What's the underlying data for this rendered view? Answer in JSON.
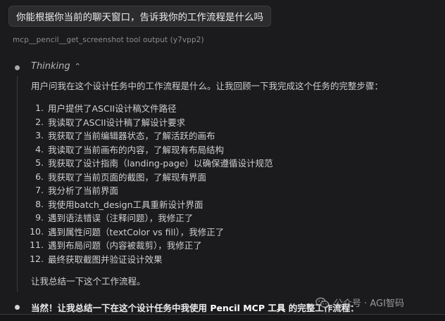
{
  "user_message": {
    "text": "你能根据你当前的聊天窗口，告诉我你的工作流程是什么吗"
  },
  "tool_output": {
    "label": "mcp__pencil__get_screenshot tool output (y7vpp2)"
  },
  "thinking": {
    "label": "Thinking",
    "toggle_icon": "chevron-up-icon",
    "intro": "用户问我在这个设计任务中的工作流程是什么。让我回顾一下我完成这个任务的完整步骤：",
    "steps": [
      {
        "num": "1.",
        "text": "用户提供了ASCII设计稿文件路径"
      },
      {
        "num": "2.",
        "text": "我读取了ASCII设计稿了解设计要求"
      },
      {
        "num": "3.",
        "text": "我获取了当前编辑器状态，了解活跃的画布"
      },
      {
        "num": "4.",
        "text": "我读取了当前画布的内容，了解现有布局结构"
      },
      {
        "num": "5.",
        "text": "我获取了设计指南（landing-page）以确保遵循设计规范"
      },
      {
        "num": "6.",
        "text": "我获取了当前页面的截图，了解现有界面"
      },
      {
        "num": "7.",
        "text": "我分析了当前界面"
      },
      {
        "num": "8.",
        "text": "我使用batch_design工具重新设计界面"
      },
      {
        "num": "9.",
        "text": "遇到语法错误（注释问题），我修正了"
      },
      {
        "num": "10.",
        "text": "遇到属性问题（textColor vs fill），我修正了"
      },
      {
        "num": "11.",
        "text": "遇到布局问题（内容被裁剪），我修正了"
      },
      {
        "num": "12.",
        "text": "最终获取截图并验证设计效果"
      }
    ],
    "outro": "让我总结一下这个工作流程。"
  },
  "answer": {
    "prefix": "当然！让我总结一下在这个设计任务中我使用 ",
    "emphasis": "Pencil MCP 工具",
    "suffix": " 的完整工作流程："
  },
  "watermark": {
    "text": "公众号 · AGI智码",
    "icon": "wechat-icon"
  }
}
